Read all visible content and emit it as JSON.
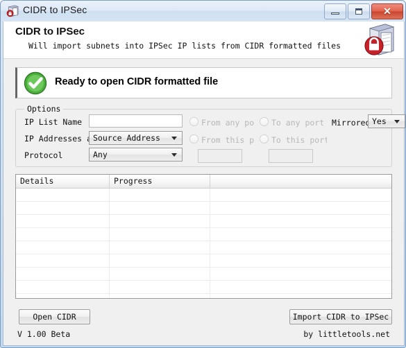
{
  "window": {
    "title": "CIDR to IPSec",
    "app_icon": "server-lock-icon",
    "controls": {
      "minimize": "minimize-button",
      "maximize": "maximize-button",
      "close_glyph": "✕"
    }
  },
  "header": {
    "title": "CIDR to IPSec",
    "subtitle": "Will import subnets into IPSec IP lists from CIDR formatted files",
    "logo_icon": "server-lock-icon"
  },
  "status": {
    "icon": "green-check-icon",
    "message": "Ready to open CIDR formatted file"
  },
  "options": {
    "legend": "Options",
    "ip_list_name": {
      "label": "IP List Name",
      "value": "",
      "placeholder": ""
    },
    "ip_addresses_are": {
      "label": "IP Addresses are",
      "value": "Source Address"
    },
    "protocol": {
      "label": "Protocol",
      "value": "Any"
    },
    "mirrored": {
      "label": "Mirrored",
      "value": "Yes"
    },
    "radios": {
      "from_any_port": "From any port",
      "to_any_port": "To any port",
      "from_this_port": "From this port",
      "to_this_port": "To this port"
    },
    "ports": {
      "from_port_value": "",
      "to_port_value": ""
    }
  },
  "list": {
    "columns": [
      "Details",
      "Progress",
      ""
    ],
    "rows": []
  },
  "buttons": {
    "open_cidr": "Open CIDR",
    "import_cidr": "Import CIDR to IPSec"
  },
  "footer": {
    "version": "V 1.00 Beta",
    "credit": "by littletools.net"
  },
  "colors": {
    "titlebar_border": "#7c9dc0",
    "close_red": "#c94430",
    "status_green": "#3ea832",
    "lock_red": "#c6222a",
    "accent_bar": "#666666"
  }
}
